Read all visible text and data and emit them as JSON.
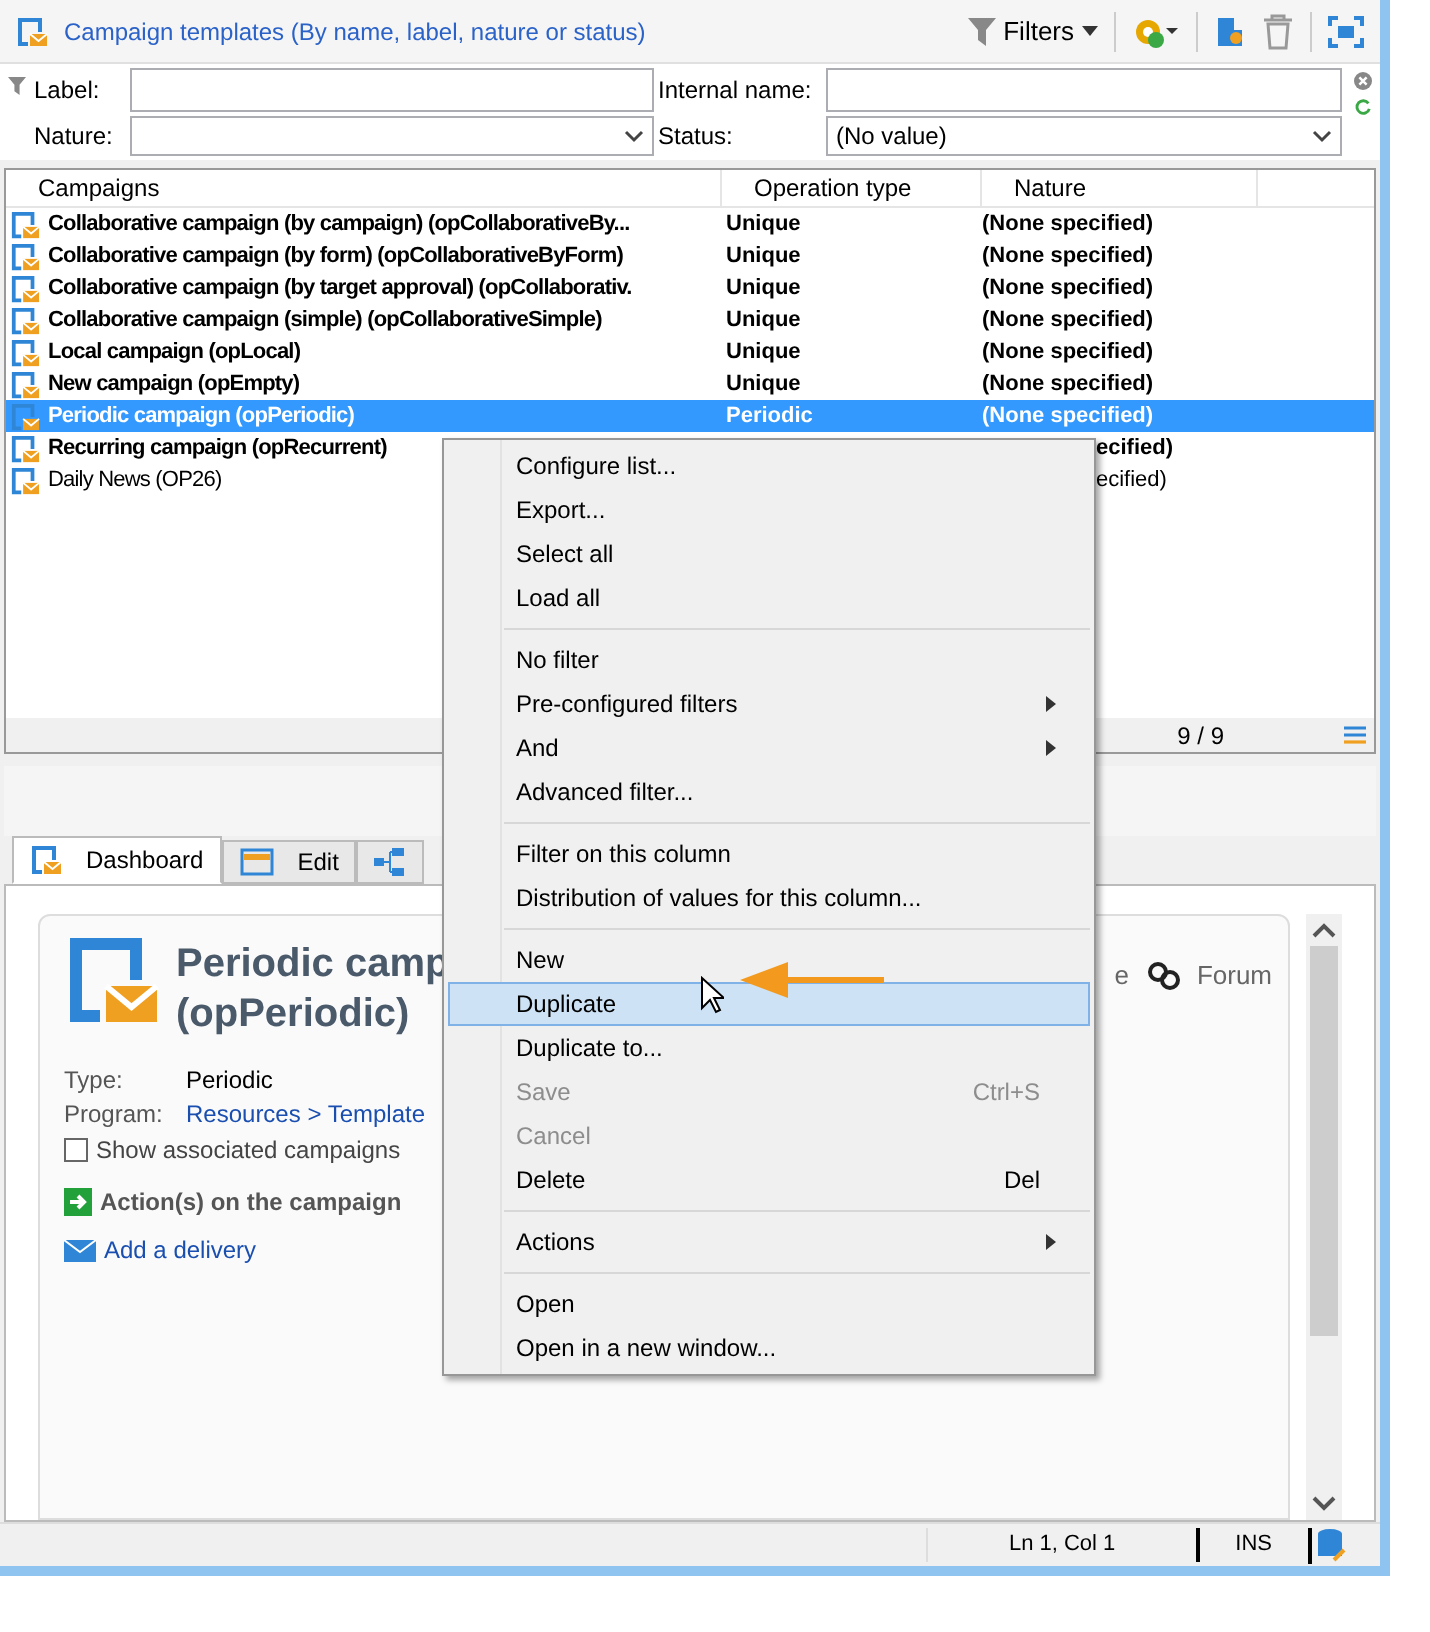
{
  "header": {
    "title": "Campaign templates (By name, label, nature or status)",
    "filters_button": "Filters"
  },
  "filter_form": {
    "label": {
      "label": "Label:"
    },
    "internal_name": {
      "label": "Internal name:"
    },
    "nature": {
      "label": "Nature:"
    },
    "status": {
      "label": "Status:",
      "value": "(No value)"
    }
  },
  "table": {
    "columns": [
      "Campaigns",
      "Operation type",
      "Nature"
    ],
    "rows": [
      {
        "name": "Collaborative campaign (by campaign) (opCollaborativeBy...",
        "operation_type": "Unique",
        "nature": "(None specified)",
        "bold": true,
        "selected": false
      },
      {
        "name": "Collaborative campaign (by form) (opCollaborativeByForm)",
        "operation_type": "Unique",
        "nature": "(None specified)",
        "bold": true,
        "selected": false
      },
      {
        "name": "Collaborative campaign (by target approval) (opCollaborativ.",
        "operation_type": "Unique",
        "nature": "(None specified)",
        "bold": true,
        "selected": false
      },
      {
        "name": "Collaborative campaign (simple) (opCollaborativeSimple)",
        "operation_type": "Unique",
        "nature": "(None specified)",
        "bold": true,
        "selected": false
      },
      {
        "name": "Local campaign (opLocal)",
        "operation_type": "Unique",
        "nature": "(None specified)",
        "bold": true,
        "selected": false
      },
      {
        "name": "New campaign (opEmpty)",
        "operation_type": "Unique",
        "nature": "(None specified)",
        "bold": true,
        "selected": false
      },
      {
        "name": "Periodic campaign (opPeriodic)",
        "operation_type": "Periodic",
        "nature": "(None specified)",
        "bold": true,
        "selected": true
      },
      {
        "name": "Recurring campaign (opRecurrent)",
        "nature": "ecified)",
        "bold": true,
        "selected": false
      },
      {
        "name": "Daily News (OP26)",
        "nature": "ecified)",
        "bold": false,
        "selected": false
      }
    ],
    "count": "9 / 9"
  },
  "tabs": [
    {
      "label": "Dashboard",
      "selected": true
    },
    {
      "label": "Edit",
      "selected": false
    },
    {
      "selected": false
    }
  ],
  "dashboard": {
    "title_line_1": "Periodic camp",
    "title_line_2": "(opPeriodic)",
    "header_links": [
      "e",
      "Forum"
    ],
    "type_label": "Type:",
    "type_value": "Periodic",
    "program_label": "Program:",
    "program_value": "Resources > Template",
    "show_associated": {
      "label": "Show associated campaigns",
      "checked": false
    },
    "actions_heading": "Action(s) on the campaign",
    "add_delivery": "Add a delivery"
  },
  "context_menu": [
    {
      "kind": "item",
      "label": "Configure list...",
      "disabled": false,
      "selected": false
    },
    {
      "kind": "item",
      "label": "Export...",
      "disabled": false,
      "selected": false
    },
    {
      "kind": "item",
      "label": "Select all",
      "disabled": false,
      "selected": false
    },
    {
      "kind": "item",
      "label": "Load all",
      "disabled": false,
      "selected": false
    },
    {
      "kind": "separator"
    },
    {
      "kind": "item",
      "label": "No filter",
      "disabled": false,
      "selected": false
    },
    {
      "kind": "item",
      "label": "Pre-configured filters",
      "submenu": true,
      "disabled": false,
      "selected": false
    },
    {
      "kind": "item",
      "label": "And",
      "submenu": true,
      "disabled": false,
      "selected": false
    },
    {
      "kind": "item",
      "label": "Advanced filter...",
      "disabled": false,
      "selected": false
    },
    {
      "kind": "separator"
    },
    {
      "kind": "item",
      "label": "Filter on this column",
      "disabled": false,
      "selected": false
    },
    {
      "kind": "item",
      "label": "Distribution of values for this column...",
      "disabled": false,
      "selected": false
    },
    {
      "kind": "separator"
    },
    {
      "kind": "item",
      "label": "New",
      "disabled": false,
      "selected": false
    },
    {
      "kind": "item",
      "label": "Duplicate",
      "disabled": false,
      "selected": true
    },
    {
      "kind": "item",
      "label": "Duplicate to...",
      "disabled": false,
      "selected": false
    },
    {
      "kind": "item",
      "label": "Save",
      "shortcut": "Ctrl+S",
      "disabled": true,
      "selected": false
    },
    {
      "kind": "item",
      "label": "Cancel",
      "disabled": true,
      "selected": false
    },
    {
      "kind": "item",
      "label": "Delete",
      "shortcut": "Del",
      "disabled": false,
      "selected": false
    },
    {
      "kind": "separator"
    },
    {
      "kind": "item",
      "label": "Actions",
      "submenu": true,
      "disabled": false,
      "selected": false
    },
    {
      "kind": "separator"
    },
    {
      "kind": "item",
      "label": "Open",
      "disabled": false,
      "selected": false
    },
    {
      "kind": "item",
      "label": "Open in a new window...",
      "disabled": false,
      "selected": false
    }
  ],
  "status_bar": {
    "position": "Ln 1, Col 1",
    "mode": "INS"
  }
}
